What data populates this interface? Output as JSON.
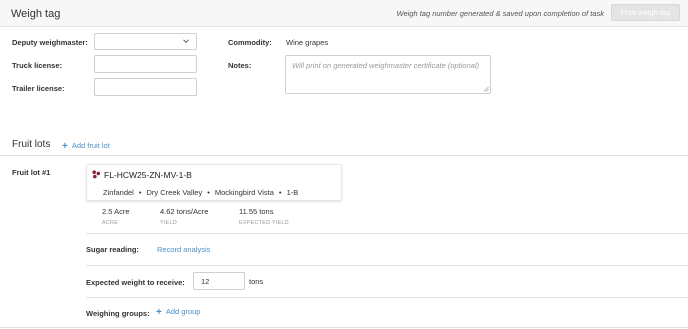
{
  "header": {
    "title": "Weigh tag",
    "note": "Weigh tag number generated & saved upon completion of task",
    "print_button": "Print weigh tag"
  },
  "form": {
    "deputy_weighmaster": {
      "label": "Deputy weighmaster:",
      "value": ""
    },
    "truck_license": {
      "label": "Truck license:",
      "value": ""
    },
    "trailer_license": {
      "label": "Trailer license:",
      "value": ""
    },
    "commodity": {
      "label": "Commodity:",
      "value": "Wine grapes"
    },
    "notes": {
      "label": "Notes:",
      "placeholder": "Will print on generated weighmaster certificate (optional)"
    }
  },
  "fruit_lots": {
    "title": "Fruit lots",
    "add_label": "Add fruit lot",
    "lots": [
      {
        "label": "Fruit lot #1",
        "code": "FL-HCW25-ZN-MV-1-B",
        "variety": "Zinfandel",
        "region": "Dry Creek Valley",
        "vineyard": "Mockingbird Vista",
        "block": "1-B",
        "separator": "•",
        "stats": [
          {
            "value": "2.5 Acre",
            "caption": "ACRE"
          },
          {
            "value": "4.62 tons/Acre",
            "caption": "YIELD"
          },
          {
            "value": "11.55 tons",
            "caption": "EXPECTED YIELD"
          }
        ],
        "sugar_reading": {
          "label": "Sugar reading:",
          "action": "Record analysis"
        },
        "expected_weight": {
          "label": "Expected weight to receive:",
          "value": "12",
          "unit": "tons"
        },
        "weighing_groups": {
          "label": "Weighing groups:",
          "action": "Add group"
        }
      }
    ]
  },
  "colors": {
    "accent": "#4a90c8",
    "grape": "#8b2a3a",
    "header_bg": "#f7f7f7"
  },
  "icons": {
    "select_chevron": "chevron-down-icon",
    "add": "plus-icon",
    "lot": "grapes-icon",
    "resize": "resize-grip-icon"
  }
}
